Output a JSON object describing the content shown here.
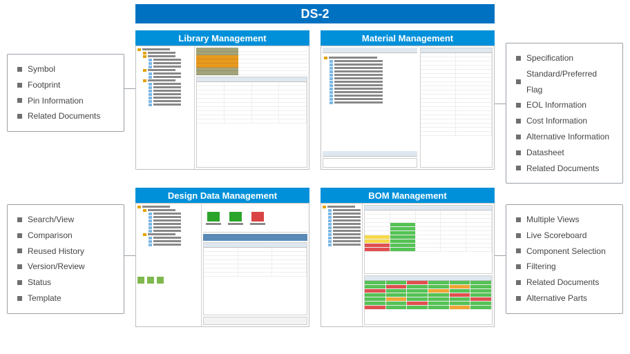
{
  "title": "DS-2",
  "quads": {
    "library": {
      "header": "Library Management"
    },
    "material": {
      "header": "Material Management"
    },
    "design": {
      "header": "Design Data Management"
    },
    "bom": {
      "header": "BOM Management"
    }
  },
  "callouts": {
    "library": [
      "Symbol",
      "Footprint",
      "Pin Information",
      "Related Documents"
    ],
    "design": [
      "Search/View",
      "Comparison",
      "Reused History",
      "Version/Review",
      "Status",
      "Template"
    ],
    "material": [
      "Specification",
      "Standard/Preferred Flag",
      "EOL Information",
      "Cost Information",
      "Alternative Information",
      "Datasheet",
      "Related Documents"
    ],
    "bom": [
      "Multiple Views",
      "Live Scoreboard",
      "Component Selection",
      "Filtering",
      "Related Documents",
      "Alternative Parts"
    ]
  }
}
